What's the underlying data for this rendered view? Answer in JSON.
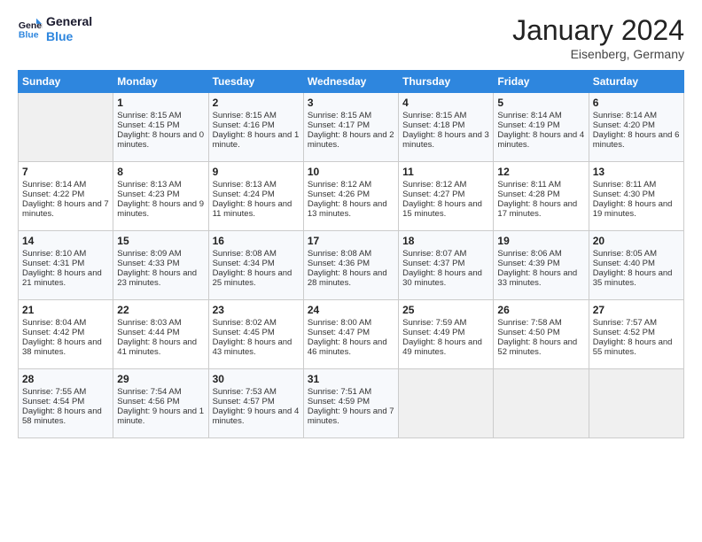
{
  "header": {
    "logo_line1": "General",
    "logo_line2": "Blue",
    "month": "January 2024",
    "location": "Eisenberg, Germany"
  },
  "days_of_week": [
    "Sunday",
    "Monday",
    "Tuesday",
    "Wednesday",
    "Thursday",
    "Friday",
    "Saturday"
  ],
  "weeks": [
    [
      {
        "day": "",
        "sunrise": "",
        "sunset": "",
        "daylight": ""
      },
      {
        "day": "1",
        "sunrise": "Sunrise: 8:15 AM",
        "sunset": "Sunset: 4:15 PM",
        "daylight": "Daylight: 8 hours and 0 minutes."
      },
      {
        "day": "2",
        "sunrise": "Sunrise: 8:15 AM",
        "sunset": "Sunset: 4:16 PM",
        "daylight": "Daylight: 8 hours and 1 minute."
      },
      {
        "day": "3",
        "sunrise": "Sunrise: 8:15 AM",
        "sunset": "Sunset: 4:17 PM",
        "daylight": "Daylight: 8 hours and 2 minutes."
      },
      {
        "day": "4",
        "sunrise": "Sunrise: 8:15 AM",
        "sunset": "Sunset: 4:18 PM",
        "daylight": "Daylight: 8 hours and 3 minutes."
      },
      {
        "day": "5",
        "sunrise": "Sunrise: 8:14 AM",
        "sunset": "Sunset: 4:19 PM",
        "daylight": "Daylight: 8 hours and 4 minutes."
      },
      {
        "day": "6",
        "sunrise": "Sunrise: 8:14 AM",
        "sunset": "Sunset: 4:20 PM",
        "daylight": "Daylight: 8 hours and 6 minutes."
      }
    ],
    [
      {
        "day": "7",
        "sunrise": "Sunrise: 8:14 AM",
        "sunset": "Sunset: 4:22 PM",
        "daylight": "Daylight: 8 hours and 7 minutes."
      },
      {
        "day": "8",
        "sunrise": "Sunrise: 8:13 AM",
        "sunset": "Sunset: 4:23 PM",
        "daylight": "Daylight: 8 hours and 9 minutes."
      },
      {
        "day": "9",
        "sunrise": "Sunrise: 8:13 AM",
        "sunset": "Sunset: 4:24 PM",
        "daylight": "Daylight: 8 hours and 11 minutes."
      },
      {
        "day": "10",
        "sunrise": "Sunrise: 8:12 AM",
        "sunset": "Sunset: 4:26 PM",
        "daylight": "Daylight: 8 hours and 13 minutes."
      },
      {
        "day": "11",
        "sunrise": "Sunrise: 8:12 AM",
        "sunset": "Sunset: 4:27 PM",
        "daylight": "Daylight: 8 hours and 15 minutes."
      },
      {
        "day": "12",
        "sunrise": "Sunrise: 8:11 AM",
        "sunset": "Sunset: 4:28 PM",
        "daylight": "Daylight: 8 hours and 17 minutes."
      },
      {
        "day": "13",
        "sunrise": "Sunrise: 8:11 AM",
        "sunset": "Sunset: 4:30 PM",
        "daylight": "Daylight: 8 hours and 19 minutes."
      }
    ],
    [
      {
        "day": "14",
        "sunrise": "Sunrise: 8:10 AM",
        "sunset": "Sunset: 4:31 PM",
        "daylight": "Daylight: 8 hours and 21 minutes."
      },
      {
        "day": "15",
        "sunrise": "Sunrise: 8:09 AM",
        "sunset": "Sunset: 4:33 PM",
        "daylight": "Daylight: 8 hours and 23 minutes."
      },
      {
        "day": "16",
        "sunrise": "Sunrise: 8:08 AM",
        "sunset": "Sunset: 4:34 PM",
        "daylight": "Daylight: 8 hours and 25 minutes."
      },
      {
        "day": "17",
        "sunrise": "Sunrise: 8:08 AM",
        "sunset": "Sunset: 4:36 PM",
        "daylight": "Daylight: 8 hours and 28 minutes."
      },
      {
        "day": "18",
        "sunrise": "Sunrise: 8:07 AM",
        "sunset": "Sunset: 4:37 PM",
        "daylight": "Daylight: 8 hours and 30 minutes."
      },
      {
        "day": "19",
        "sunrise": "Sunrise: 8:06 AM",
        "sunset": "Sunset: 4:39 PM",
        "daylight": "Daylight: 8 hours and 33 minutes."
      },
      {
        "day": "20",
        "sunrise": "Sunrise: 8:05 AM",
        "sunset": "Sunset: 4:40 PM",
        "daylight": "Daylight: 8 hours and 35 minutes."
      }
    ],
    [
      {
        "day": "21",
        "sunrise": "Sunrise: 8:04 AM",
        "sunset": "Sunset: 4:42 PM",
        "daylight": "Daylight: 8 hours and 38 minutes."
      },
      {
        "day": "22",
        "sunrise": "Sunrise: 8:03 AM",
        "sunset": "Sunset: 4:44 PM",
        "daylight": "Daylight: 8 hours and 41 minutes."
      },
      {
        "day": "23",
        "sunrise": "Sunrise: 8:02 AM",
        "sunset": "Sunset: 4:45 PM",
        "daylight": "Daylight: 8 hours and 43 minutes."
      },
      {
        "day": "24",
        "sunrise": "Sunrise: 8:00 AM",
        "sunset": "Sunset: 4:47 PM",
        "daylight": "Daylight: 8 hours and 46 minutes."
      },
      {
        "day": "25",
        "sunrise": "Sunrise: 7:59 AM",
        "sunset": "Sunset: 4:49 PM",
        "daylight": "Daylight: 8 hours and 49 minutes."
      },
      {
        "day": "26",
        "sunrise": "Sunrise: 7:58 AM",
        "sunset": "Sunset: 4:50 PM",
        "daylight": "Daylight: 8 hours and 52 minutes."
      },
      {
        "day": "27",
        "sunrise": "Sunrise: 7:57 AM",
        "sunset": "Sunset: 4:52 PM",
        "daylight": "Daylight: 8 hours and 55 minutes."
      }
    ],
    [
      {
        "day": "28",
        "sunrise": "Sunrise: 7:55 AM",
        "sunset": "Sunset: 4:54 PM",
        "daylight": "Daylight: 8 hours and 58 minutes."
      },
      {
        "day": "29",
        "sunrise": "Sunrise: 7:54 AM",
        "sunset": "Sunset: 4:56 PM",
        "daylight": "Daylight: 9 hours and 1 minute."
      },
      {
        "day": "30",
        "sunrise": "Sunrise: 7:53 AM",
        "sunset": "Sunset: 4:57 PM",
        "daylight": "Daylight: 9 hours and 4 minutes."
      },
      {
        "day": "31",
        "sunrise": "Sunrise: 7:51 AM",
        "sunset": "Sunset: 4:59 PM",
        "daylight": "Daylight: 9 hours and 7 minutes."
      },
      {
        "day": "",
        "sunrise": "",
        "sunset": "",
        "daylight": ""
      },
      {
        "day": "",
        "sunrise": "",
        "sunset": "",
        "daylight": ""
      },
      {
        "day": "",
        "sunrise": "",
        "sunset": "",
        "daylight": ""
      }
    ]
  ]
}
